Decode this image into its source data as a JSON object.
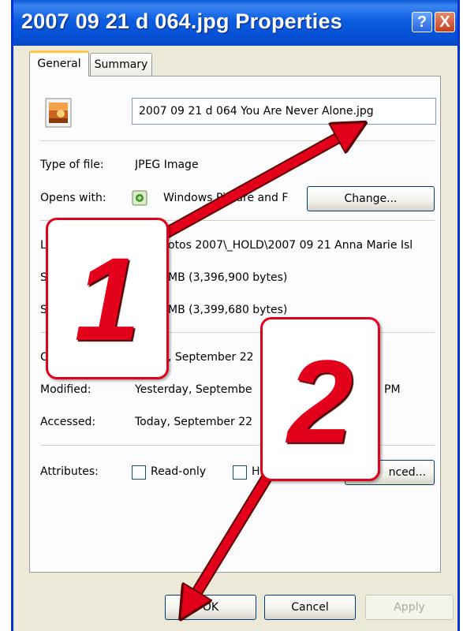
{
  "window": {
    "title": "2007 09 21 d 064.jpg Properties"
  },
  "titlebar_buttons": {
    "help": "?",
    "close": "X"
  },
  "tabs": [
    {
      "label": "General"
    },
    {
      "label": "Summary"
    }
  ],
  "file": {
    "icon": "jpeg-file-icon",
    "name_value": "2007 09 21 d 064 You Are Never Alone.jpg"
  },
  "type_row": {
    "label": "Type of file:",
    "value": "JPEG Image"
  },
  "opens_row": {
    "label": "Opens with:",
    "value": "Windows Picture and F",
    "change_button": "Change...",
    "change_accel": "C"
  },
  "location_row": {
    "label_visible": "L",
    "value_visible": "otos 2007\\_HOLD\\2007 09 21 Anna Marie Isl"
  },
  "size_row": {
    "label_visible": "S",
    "value_visible": "MB (3,396,900 bytes)"
  },
  "size_on_disk_row": {
    "label_visible": "S",
    "value_visible": "MB (3,399,680 bytes)"
  },
  "created_row": {
    "label_visible": "C",
    "value_visible": ", September 22"
  },
  "modified_row": {
    "label": "Modified:",
    "value_visible": "Yesterday, Septembe",
    "value_tail": "PM"
  },
  "accessed_row": {
    "label": "Accessed:",
    "value_visible": "Today, September 22"
  },
  "attributes_row": {
    "label": "Attributes:",
    "readonly_label": "Read-only",
    "hidden_label_visible": "Hi",
    "advanced_label_visible": "nced..."
  },
  "buttons": {
    "ok": "OK",
    "cancel": "Cancel",
    "apply": "Apply"
  },
  "annotations": [
    {
      "number": "1"
    },
    {
      "number": "2"
    }
  ],
  "colors": {
    "titlebar": "#0b5ce0",
    "dialog_bg": "#ece9d8",
    "callout_red": "#e3001b",
    "tab_highlight": "#ffc83c"
  }
}
